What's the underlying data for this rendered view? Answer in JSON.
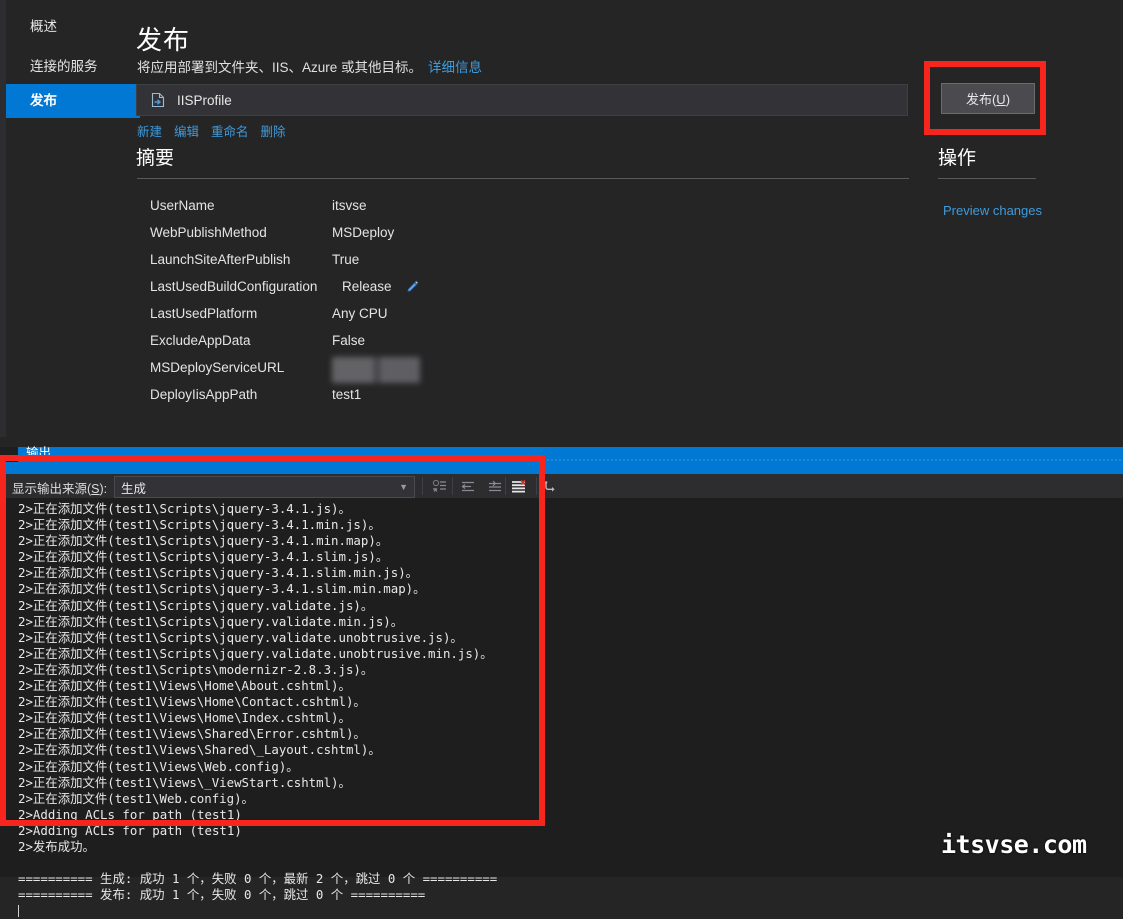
{
  "sidebar": {
    "items": [
      {
        "label": "概述",
        "selected": false
      },
      {
        "label": "连接的服务",
        "selected": false
      },
      {
        "label": "发布",
        "selected": true
      }
    ]
  },
  "page": {
    "title": "发布",
    "description": "将应用部署到文件夹、IIS、Azure 或其他目标。",
    "description_link": "详细信息",
    "profile_name": "IISProfile",
    "profile_icon": "publish-profile-icon",
    "profile_links": [
      "新建",
      "编辑",
      "重命名",
      "删除"
    ],
    "summary_heading": "摘要",
    "operations_heading": "操作",
    "preview_changes_link": "Preview changes",
    "publish_button": "发布(U)",
    "publish_button_accesskey": "U"
  },
  "summary": {
    "rows": [
      {
        "key": "UserName",
        "value": "itsvse",
        "type": "text"
      },
      {
        "key": "WebPublishMethod",
        "value": "MSDeploy",
        "type": "text"
      },
      {
        "key": "LaunchSiteAfterPublish",
        "value": "True",
        "type": "text"
      },
      {
        "key": "LastUsedBuildConfiguration",
        "value": "Release",
        "type": "editable"
      },
      {
        "key": "LastUsedPlatform",
        "value": "Any CPU",
        "type": "text"
      },
      {
        "key": "ExcludeAppData",
        "value": "False",
        "type": "text"
      },
      {
        "key": "MSDeployServiceURL",
        "value": "",
        "type": "blurred"
      },
      {
        "key": "DeployIisAppPath",
        "value": "test1",
        "type": "text"
      }
    ]
  },
  "output": {
    "panel_title": "输出",
    "source_label": "显示输出来源(S):",
    "source_label_accesskey": "S",
    "source_value": "生成",
    "toolbar_icons": [
      "clear-all-icon",
      "wrap-text-icon",
      "scroll-lock-icon",
      "toggle-word-wrap-icon",
      "go-to-message-icon"
    ],
    "lines": [
      "2>正在添加文件(test1\\Scripts\\jquery-3.4.1.js)。",
      "2>正在添加文件(test1\\Scripts\\jquery-3.4.1.min.js)。",
      "2>正在添加文件(test1\\Scripts\\jquery-3.4.1.min.map)。",
      "2>正在添加文件(test1\\Scripts\\jquery-3.4.1.slim.js)。",
      "2>正在添加文件(test1\\Scripts\\jquery-3.4.1.slim.min.js)。",
      "2>正在添加文件(test1\\Scripts\\jquery-3.4.1.slim.min.map)。",
      "2>正在添加文件(test1\\Scripts\\jquery.validate.js)。",
      "2>正在添加文件(test1\\Scripts\\jquery.validate.min.js)。",
      "2>正在添加文件(test1\\Scripts\\jquery.validate.unobtrusive.js)。",
      "2>正在添加文件(test1\\Scripts\\jquery.validate.unobtrusive.min.js)。",
      "2>正在添加文件(test1\\Scripts\\modernizr-2.8.3.js)。",
      "2>正在添加文件(test1\\Views\\Home\\About.cshtml)。",
      "2>正在添加文件(test1\\Views\\Home\\Contact.cshtml)。",
      "2>正在添加文件(test1\\Views\\Home\\Index.cshtml)。",
      "2>正在添加文件(test1\\Views\\Shared\\Error.cshtml)。",
      "2>正在添加文件(test1\\Views\\Shared\\_Layout.cshtml)。",
      "2>正在添加文件(test1\\Views\\Web.config)。",
      "2>正在添加文件(test1\\Views\\_ViewStart.cshtml)。",
      "2>正在添加文件(test1\\Web.config)。",
      "2>Adding ACLs for path (test1)",
      "2>Adding ACLs for path (test1)",
      "2>发布成功。",
      "",
      "========== 生成: 成功 1 个，失败 0 个，最新 2 个，跳过 0 个 ==========",
      "========== 发布: 成功 1 个，失败 0 个，跳过 0 个 =========="
    ]
  },
  "watermark": "itsvse.com",
  "colors": {
    "accent_blue": "#0078D4",
    "link_blue": "#3F9BDC",
    "highlight_red": "#F6251D",
    "panel_bg": "#252526",
    "output_bg": "#1E1E1E"
  }
}
